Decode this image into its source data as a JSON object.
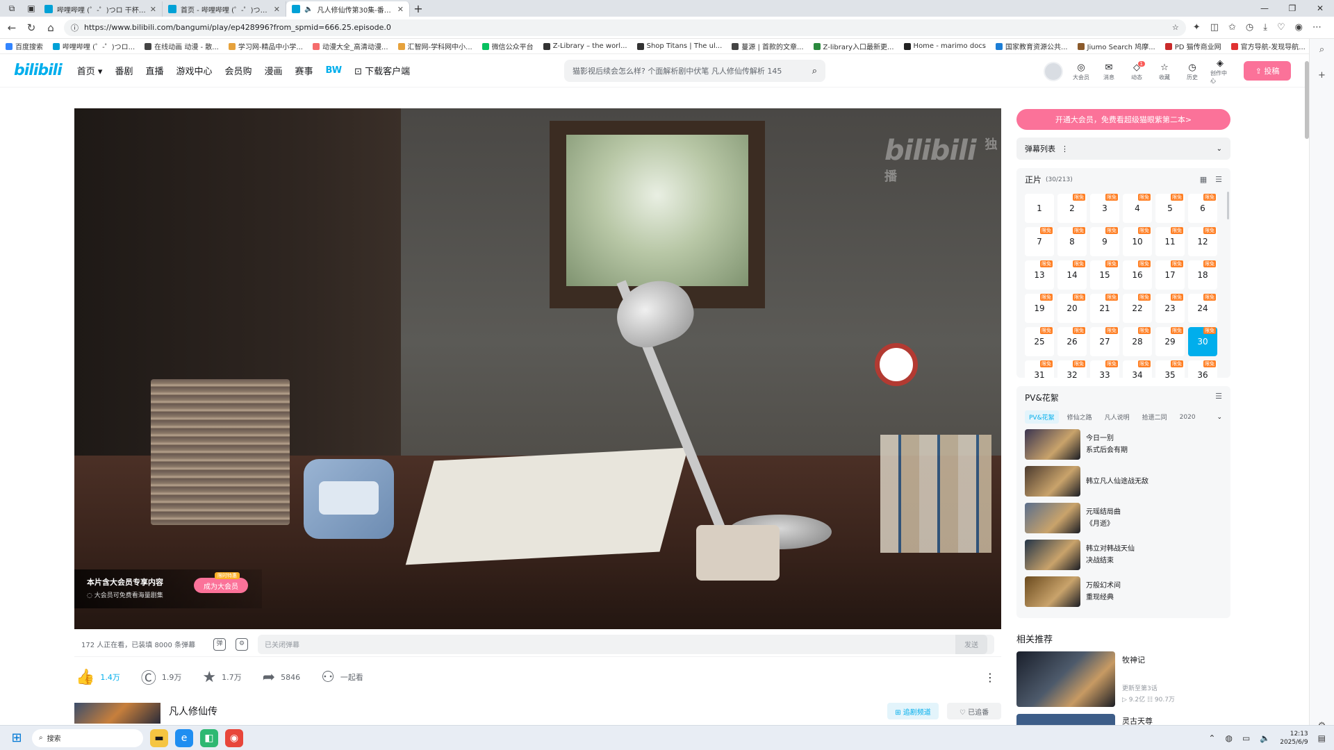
{
  "browser": {
    "tabs": [
      {
        "title": "哔哩哔哩 (゜-゜)つロ 干杯~-bilibili",
        "active": false
      },
      {
        "title": "首页 - 哔哩哔哩 (゜-゜)つロ 干杯~",
        "active": false
      },
      {
        "title": "凡人修仙传第30集-番剧-高清",
        "active": true
      }
    ],
    "url": "https://www.bilibili.com/bangumi/play/ep428996?from_spmid=666.25.episode.0",
    "bookmarks": [
      {
        "label": "百度搜索",
        "color": "#3385ff"
      },
      {
        "label": "哔哩哔哩 (゜-゜)つロ...",
        "color": "#00a1d6"
      },
      {
        "label": "在线动画 动漫 - 散...",
        "color": "#444444"
      },
      {
        "label": "学习网-精品中小学...",
        "color": "#e6a23c"
      },
      {
        "label": "动漫大全_高清动漫...",
        "color": "#f56c6c"
      },
      {
        "label": "汇智网-学科网中小...",
        "color": "#e6a23c"
      },
      {
        "label": "微信公众平台",
        "color": "#07c160"
      },
      {
        "label": "Z-Library – the worl...",
        "color": "#333333"
      },
      {
        "label": "Shop Titans | The ul...",
        "color": "#333333"
      },
      {
        "label": "蔓源 | 首款的文章...",
        "color": "#444444"
      },
      {
        "label": "Z-library入口最新更...",
        "color": "#2b8a3e"
      },
      {
        "label": "Home - marimo docs",
        "color": "#222222"
      },
      {
        "label": "国家教育资源公共...",
        "color": "#1c7ed6"
      },
      {
        "label": "Jiumo Search 鸠摩...",
        "color": "#8b5a2b"
      },
      {
        "label": "PD 猫传商业网",
        "color": "#c92a2a"
      },
      {
        "label": "官方导航-发现导航...",
        "color": "#e03131"
      }
    ]
  },
  "header": {
    "logo": "bilibili",
    "nav": [
      "首页",
      "番剧",
      "直播",
      "游戏中心",
      "会员购",
      "漫画",
      "赛事",
      "BW",
      "下载客户端"
    ],
    "search_placeholder": "猫影视后续会怎么样? 个面解析剧中伏笔  凡人修仙传解析 145",
    "icons": [
      {
        "label": "大会员",
        "glyph": "◎"
      },
      {
        "label": "消息",
        "glyph": "✉"
      },
      {
        "label": "动态",
        "glyph": "◇",
        "badge": "1"
      },
      {
        "label": "收藏",
        "glyph": "☆"
      },
      {
        "label": "历史",
        "glyph": "◷"
      },
      {
        "label": "创作中心",
        "glyph": "◈"
      }
    ],
    "upload_label": "⇪ 投稿"
  },
  "player": {
    "watermark": "bilibili",
    "watermark_tag": "独播",
    "vip_title": "本片含大会员专享内容",
    "vip_subtitle": "◌ 大会员可免费看海量剧集",
    "vip_button": "成为大会员",
    "vip_tag": "限时特惠"
  },
  "danmaku": {
    "stats": "172 人正在看，已装填 8000 条弹幕",
    "input_placeholder": "已关闭弹幕",
    "send_label": "发送"
  },
  "actions": [
    {
      "name": "like",
      "glyph": "👍",
      "count": "1.4万",
      "active": true
    },
    {
      "name": "coin",
      "glyph": "Ⓒ",
      "count": "1.9万",
      "active": false
    },
    {
      "name": "favorite",
      "glyph": "★",
      "count": "1.7万",
      "active": false
    },
    {
      "name": "share",
      "glyph": "➦",
      "count": "5846",
      "active": false
    },
    {
      "name": "watch-together",
      "glyph": "⚇",
      "count": "一起看",
      "active": false
    }
  ],
  "info": {
    "title": "凡人修仙传",
    "follow_label": "⊞ 追剧频道",
    "followed_label": "♡ 已追番"
  },
  "sidebar": {
    "promo": "开通大会员，免费看超级猫眼紫第二本>",
    "danmaku_list": "弹幕列表",
    "episodes_title": "正片",
    "episodes_count": "(30/213)",
    "episode_tag": "限免",
    "current_episode": 30,
    "episodes": [
      1,
      2,
      3,
      4,
      5,
      6,
      7,
      8,
      9,
      10,
      11,
      12,
      13,
      14,
      15,
      16,
      17,
      18,
      19,
      20,
      21,
      22,
      23,
      24,
      25,
      26,
      27,
      28,
      29,
      30,
      31,
      32,
      33,
      34,
      35,
      36
    ],
    "pv_title": "PV&花絮",
    "pv_tabs": [
      "PV&花絮",
      "修仙之路",
      "凡人说明",
      "拾遗二同",
      "2020"
    ],
    "pv_items": [
      {
        "line1": "今日一别",
        "line2": "系式后会有期",
        "thumb": "#3b3550"
      },
      {
        "line1": "韩立凡人仙途战无敌",
        "line2": "",
        "thumb": "#4b3a2e"
      },
      {
        "line1": "元瑶结局曲",
        "line2": "《月逝》",
        "thumb": "#5a6e8c"
      },
      {
        "line1": "韩立对韩战天仙",
        "line2": "决战结束",
        "thumb": "#243548"
      },
      {
        "line1": "万般幻术间",
        "line2": "重现经典",
        "thumb": "#6a4a1e"
      }
    ],
    "related_title": "相关推荐",
    "related": [
      {
        "title": "牧神记",
        "sub1": "更新至第3话",
        "sub2": "▷ 9.2亿  ☷ 90.7万"
      },
      {
        "title": "灵古天尊"
      }
    ]
  },
  "taskbar": {
    "search": "搜索",
    "time": "12:13",
    "date": "2025/6/9"
  }
}
